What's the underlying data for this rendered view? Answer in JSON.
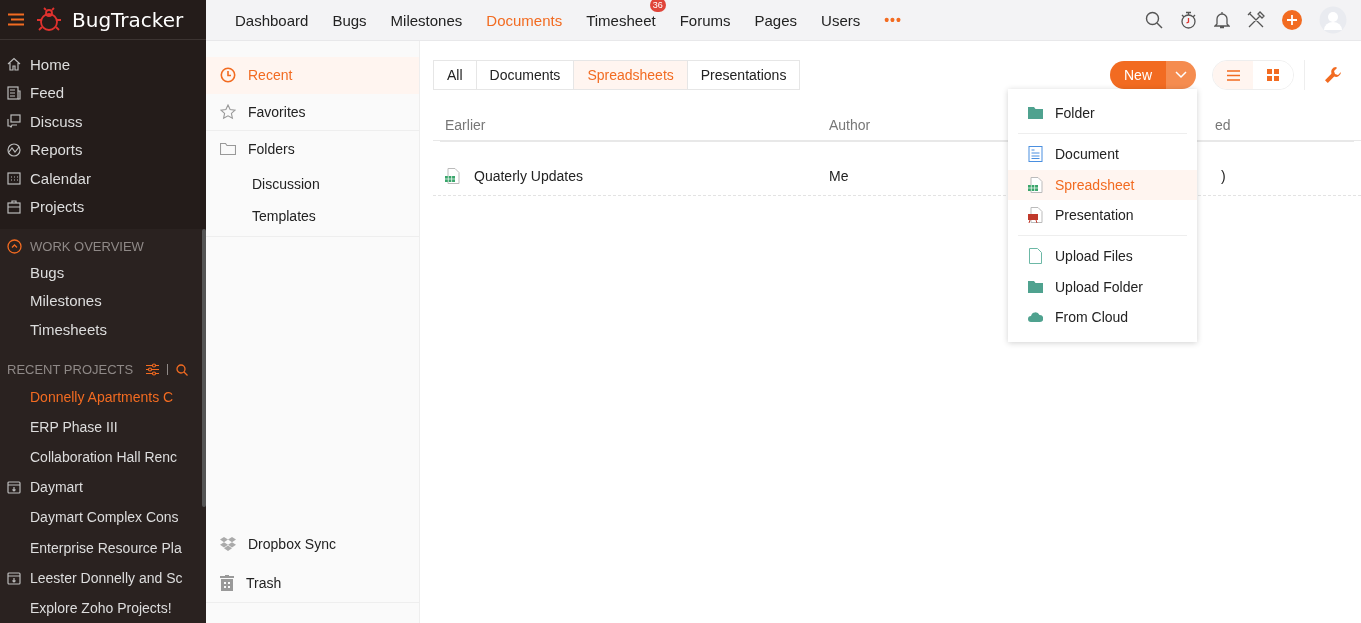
{
  "app": {
    "name": "BugTracker"
  },
  "sidebar": {
    "items": [
      {
        "label": "Home",
        "kind": "home"
      },
      {
        "label": "Feed",
        "kind": "feed"
      },
      {
        "label": "Discuss",
        "kind": "discuss"
      },
      {
        "label": "Reports",
        "kind": "reports"
      },
      {
        "label": "Calendar",
        "kind": "calendar"
      },
      {
        "label": "Projects",
        "kind": "projects"
      }
    ],
    "work_overview": {
      "title": "WORK OVERVIEW",
      "expanded": true,
      "items": [
        "Bugs",
        "Milestones",
        "Timesheets"
      ]
    },
    "recent_projects": {
      "title": "RECENT PROJECTS",
      "items": [
        {
          "label": "Donnelly Apartments C",
          "kind": "project",
          "selected": true
        },
        {
          "label": "ERP Phase III",
          "kind": "project",
          "selected": false
        },
        {
          "label": "Collaboration Hall Renc",
          "kind": "project",
          "selected": false
        },
        {
          "label": "Daymart",
          "kind": "group",
          "selected": false
        },
        {
          "label": "Daymart Complex Cons",
          "kind": "project",
          "selected": false
        },
        {
          "label": "Enterprise Resource Pla",
          "kind": "project",
          "selected": false
        },
        {
          "label": "Leester Donnelly and Sc",
          "kind": "group",
          "selected": false
        },
        {
          "label": "Explore Zoho Projects!",
          "kind": "project",
          "selected": false
        }
      ]
    }
  },
  "top_nav": [
    {
      "label": "Dashboard",
      "selected": false
    },
    {
      "label": "Bugs",
      "selected": false
    },
    {
      "label": "Milestones",
      "selected": false
    },
    {
      "label": "Documents",
      "selected": true
    },
    {
      "label": "Timesheet",
      "selected": false,
      "badge": "36"
    },
    {
      "label": "Forums",
      "selected": false
    },
    {
      "label": "Pages",
      "selected": false
    },
    {
      "label": "Users",
      "selected": false
    }
  ],
  "more": "•••",
  "doc_nav": {
    "items": [
      {
        "label": "Recent",
        "kind": "recent",
        "selected": true
      },
      {
        "label": "Favorites",
        "kind": "favorites",
        "selected": false
      },
      {
        "label": "Folders",
        "kind": "folders",
        "selected": false,
        "children": [
          {
            "label": "Discussion"
          },
          {
            "label": "Templates"
          }
        ]
      }
    ],
    "bottom": [
      {
        "label": "Dropbox Sync",
        "kind": "dropbox"
      },
      {
        "label": "Trash",
        "kind": "trash"
      }
    ]
  },
  "filter_tabs": [
    {
      "label": "All",
      "selected": false
    },
    {
      "label": "Documents",
      "selected": false
    },
    {
      "label": "Spreadsheets",
      "selected": true
    },
    {
      "label": "Presentations",
      "selected": false
    }
  ],
  "new_button": {
    "label": "New"
  },
  "view_toggle": [
    {
      "kind": "list",
      "selected": true
    },
    {
      "kind": "grid",
      "selected": false
    }
  ],
  "table": {
    "columns": [
      "Earlier",
      "Author",
      "ed"
    ],
    "rows": [
      {
        "kind": "spreadsheet",
        "name": "Quaterly Updates",
        "author": "Me",
        "column_3": ")"
      }
    ]
  },
  "new_menu": {
    "groups": [
      [
        {
          "label": "Folder",
          "kind": "folder",
          "selected": false
        }
      ],
      [
        {
          "label": "Document",
          "kind": "document",
          "selected": false
        },
        {
          "label": "Spreadsheet",
          "kind": "spreadsheet",
          "selected": true
        },
        {
          "label": "Presentation",
          "kind": "presentation",
          "selected": false
        }
      ],
      [
        {
          "label": "Upload Files",
          "kind": "file",
          "selected": false
        },
        {
          "label": "Upload Folder",
          "kind": "folder",
          "selected": false
        },
        {
          "label": "From Cloud",
          "kind": "cloud",
          "selected": false
        }
      ]
    ]
  }
}
